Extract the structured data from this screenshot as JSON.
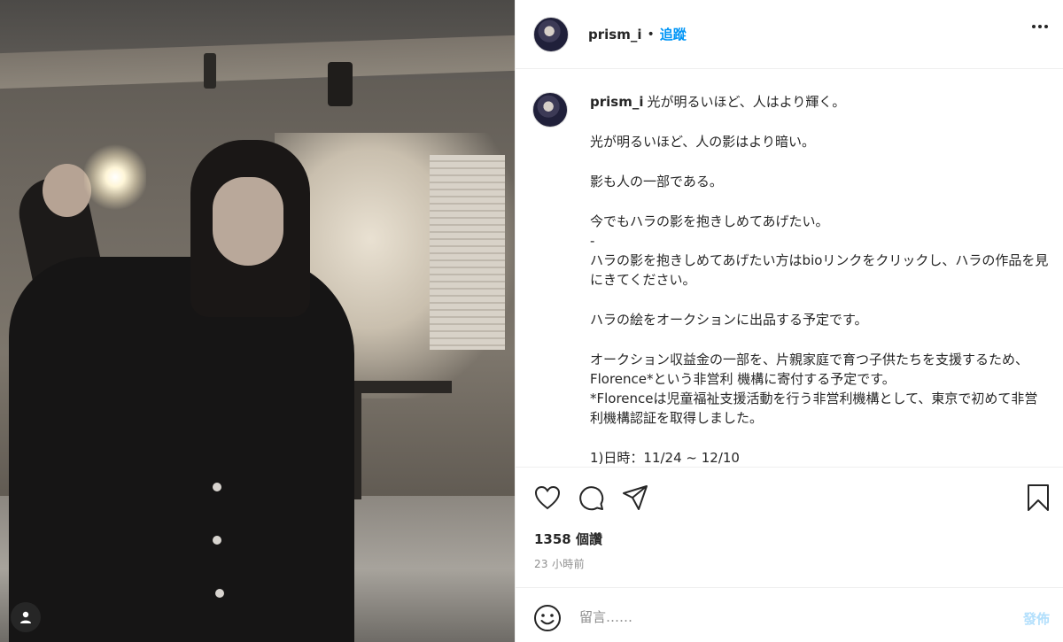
{
  "post": {
    "username": "prism_i",
    "header_dot": "•",
    "follow_label": "追蹤",
    "more_icon": "more-horizontal-icon"
  },
  "caption": {
    "username": "prism_i",
    "first_line": "光が明るいほど、人はより輝く。",
    "paragraphs": [
      "光が明るいほど、人の影はより暗い。",
      "影も人の一部である。",
      "今でもハラの影を抱きしめてあげたい。",
      "-",
      "ハラの影を抱きしめてあげたい方はbioリンクをクリックし、ハラの作品を見にきてください。",
      "ハラの絵をオークションに出品する予定です。",
      "オークション収益金の一部を、片親家庭で育つ子供たちを支援するため、 Florence*という非営利 機構に寄付する予定です。",
      "*Florenceは児童福祉支援活動を行う非営利機構として、東京で初めて非営利機構認証を取得しました。",
      "1)日時：11/24 ~ 12/10"
    ]
  },
  "actions": {
    "icons": [
      "heart-icon",
      "comment-icon",
      "share-icon",
      "bookmark-icon"
    ],
    "likes": "1358 個讚",
    "time": "23 小時前"
  },
  "comment": {
    "placeholder": "留言……",
    "post_label": "發佈",
    "emoji_icon": "emoji-icon"
  },
  "colors": {
    "accent": "#0095f6",
    "post_disabled": "#b2dffc",
    "text": "#262626",
    "muted": "#8e8e8e",
    "divider": "#efefef"
  }
}
